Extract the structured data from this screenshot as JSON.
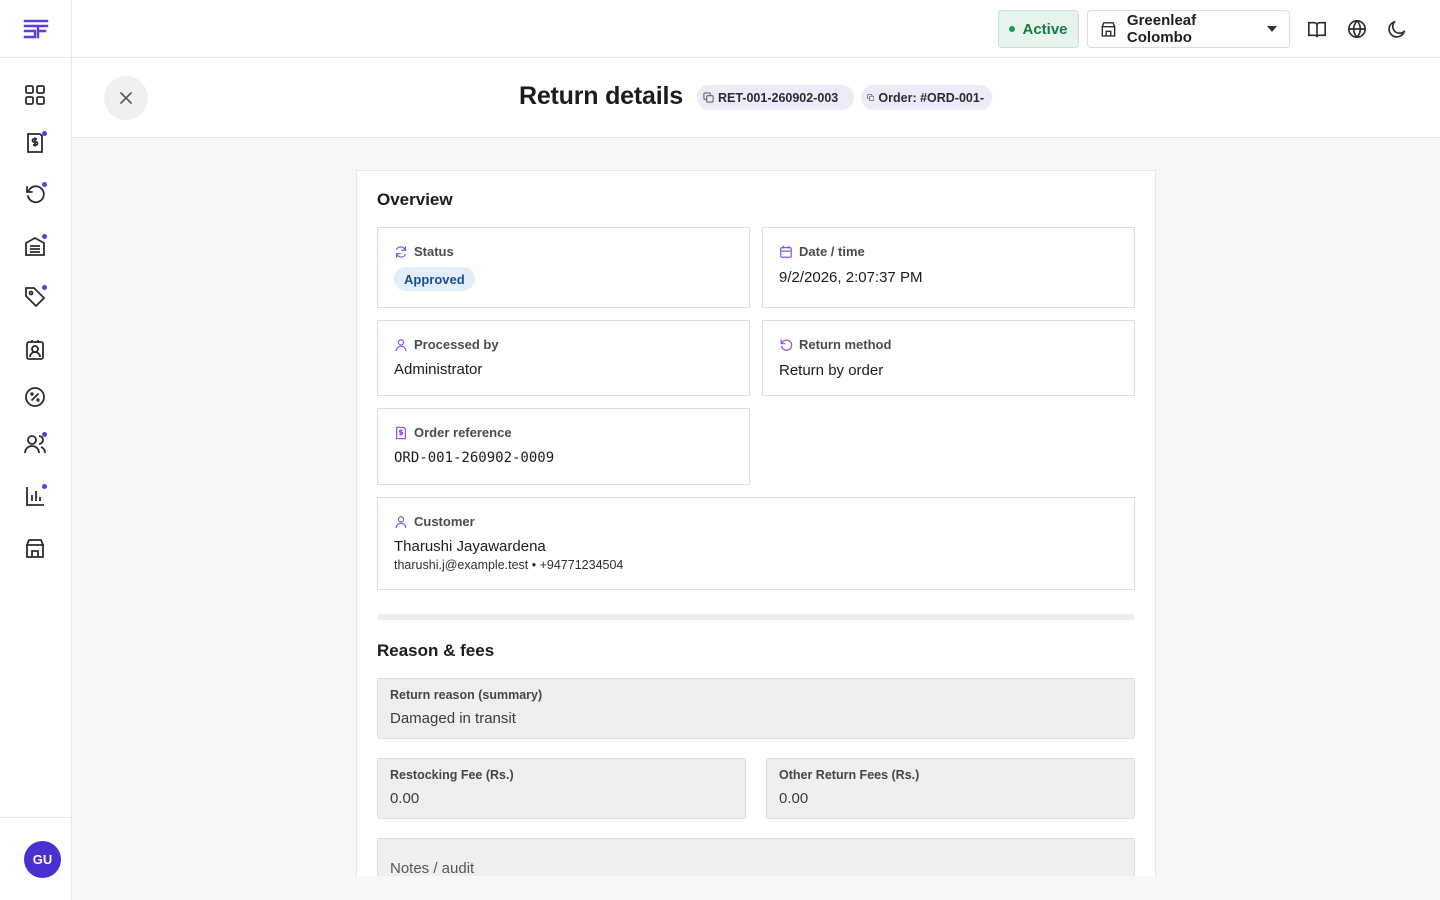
{
  "app": {
    "logo_text": "SF"
  },
  "sidebar": {
    "items": [
      {
        "name": "dashboard",
        "icon": "grid-icon",
        "dot": false
      },
      {
        "name": "orders",
        "icon": "invoice-dollar-icon",
        "dot": true
      },
      {
        "name": "returns",
        "icon": "undo-icon",
        "dot": true
      },
      {
        "name": "inventory",
        "icon": "warehouse-icon",
        "dot": true
      },
      {
        "name": "products",
        "icon": "tag-icon",
        "dot": true
      },
      {
        "name": "contacts",
        "icon": "contact-card-icon",
        "dot": false
      },
      {
        "name": "discounts",
        "icon": "discount-icon",
        "dot": false
      },
      {
        "name": "users",
        "icon": "users-icon",
        "dot": true
      },
      {
        "name": "reports",
        "icon": "bar-chart-icon",
        "dot": true
      },
      {
        "name": "stores",
        "icon": "store-icon",
        "dot": false
      }
    ],
    "avatar_initials": "GU"
  },
  "topbar": {
    "status_label": "Active",
    "store_name": "Greenleaf Colombo",
    "icons": [
      "book-icon",
      "globe-icon",
      "moon-icon"
    ]
  },
  "header": {
    "title": "Return details",
    "return_id": "RET-001-260902-003",
    "order_chip": "Order: #ORD-001-"
  },
  "overview": {
    "title": "Overview",
    "status": {
      "label": "Status",
      "value": "Approved"
    },
    "datetime": {
      "label": "Date / time",
      "value": "9/2/2026, 2:07:37 PM"
    },
    "processed_by": {
      "label": "Processed by",
      "value": "Administrator"
    },
    "return_method": {
      "label": "Return method",
      "value": "Return by order"
    },
    "order_reference": {
      "label": "Order reference",
      "value": "ORD-001-260902-0009"
    },
    "customer": {
      "label": "Customer",
      "name": "Tharushi Jayawardena",
      "contact": "tharushi.j@example.test • +94771234504"
    }
  },
  "reason_fees": {
    "title": "Reason & fees",
    "return_reason": {
      "label": "Return reason (summary)",
      "value": "Damaged in transit"
    },
    "restocking_fee": {
      "label": "Restocking Fee (Rs.)",
      "value": "0.00"
    },
    "other_fees": {
      "label": "Other Return Fees (Rs.)",
      "value": "0.00"
    },
    "notes_placeholder": "Notes / audit"
  },
  "colors": {
    "accent": "#5b3fd8",
    "active_green": "#167a43",
    "badge_blue": "#17508f"
  }
}
